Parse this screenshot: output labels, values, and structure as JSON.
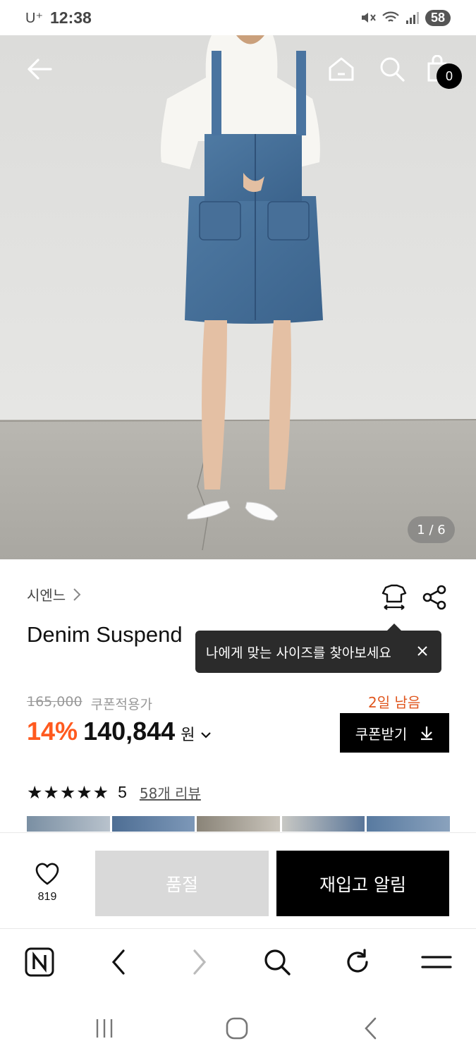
{
  "status_bar": {
    "carrier": "U⁺",
    "time": "12:38",
    "battery": "58"
  },
  "hero": {
    "cart_count": "0",
    "image_counter": "1 / 6"
  },
  "product": {
    "brand": "시엔느",
    "title": "Denim Suspend",
    "tooltip": "나에게 맞는 사이즈를 찾아보세요",
    "original_price": "165,000",
    "coupon_price_label": "쿠폰적용가",
    "days_left": "2일 남음",
    "discount": "14%",
    "price": "140,844",
    "currency": "원",
    "coupon_button": "쿠폰받기",
    "stars": "★★★★★",
    "rating_value": 5,
    "rating": "5",
    "review_link": "58개 리뷰"
  },
  "action_bar": {
    "like_count": "819",
    "soldout_label": "품절",
    "restock_label": "재입고 알림"
  },
  "colors": {
    "accent": "#ff5a1f",
    "days_left": "#e0561e",
    "tooltip_bg": "#2b2b2b",
    "soldout_bg": "#d9d9d9",
    "primary_button": "#000000"
  },
  "icons": [
    "back-arrow-icon",
    "home-icon",
    "search-icon",
    "shopping-bag-icon",
    "size-guide-icon",
    "share-icon",
    "close-icon",
    "download-icon",
    "heart-icon",
    "naver-n-icon",
    "browser-back-icon",
    "browser-forward-icon",
    "browser-search-icon",
    "reload-icon",
    "menu-icon",
    "recent-apps-icon",
    "home-circle-icon",
    "system-back-icon"
  ]
}
